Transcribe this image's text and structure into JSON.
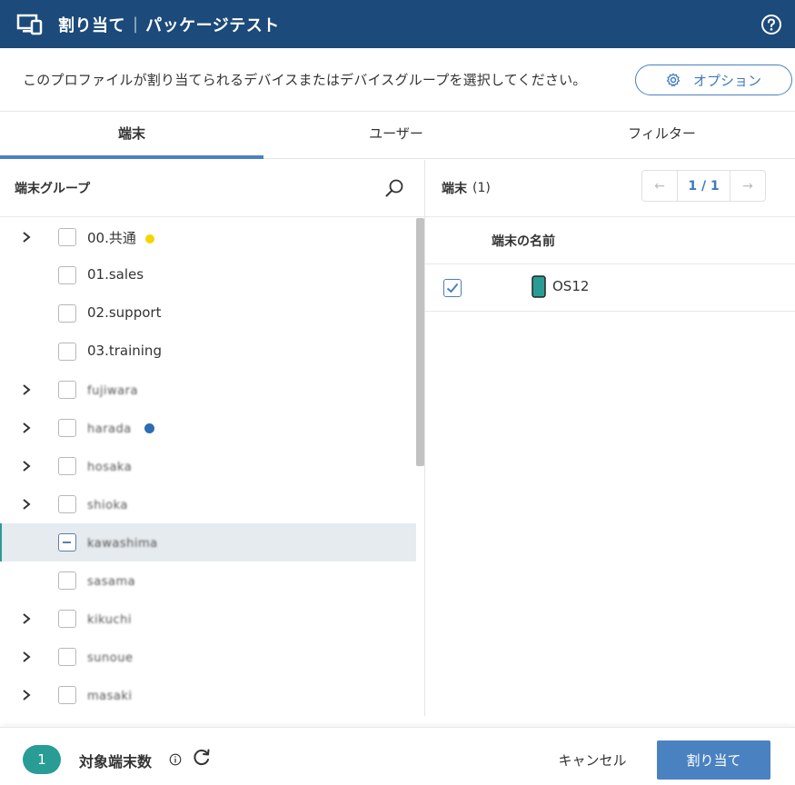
{
  "header": {
    "title_main": "割り当て",
    "separator": "|",
    "title_sub": "パッケージテスト",
    "app_icon": "devices-icon",
    "help_icon": "help-circle-icon"
  },
  "instruction": {
    "text": "このプロファイルが割り当てられるデバイスまたはデバイスグループを選択してください。",
    "option_label": "オプション",
    "option_icon": "gear-icon"
  },
  "tabs": [
    {
      "label": "端末",
      "active": true
    },
    {
      "label": "ユーザー",
      "active": false
    },
    {
      "label": "フィルター",
      "active": false
    }
  ],
  "left_panel": {
    "title": "端末グループ",
    "search_icon": "search-icon",
    "groups": [
      {
        "label": "00.共通",
        "expandable": true,
        "state": "unchecked",
        "marker": "yellow-dot"
      },
      {
        "label": "01.sales",
        "expandable": false,
        "state": "unchecked"
      },
      {
        "label": "02.support",
        "expandable": false,
        "state": "unchecked"
      },
      {
        "label": "03.training",
        "expandable": false,
        "state": "unchecked"
      },
      {
        "label": "fujiwara",
        "expandable": true,
        "state": "unchecked",
        "obscured": true
      },
      {
        "label": "harada",
        "expandable": true,
        "state": "unchecked",
        "obscured": true,
        "marker": "blue-dot"
      },
      {
        "label": "hosaka",
        "expandable": true,
        "state": "unchecked",
        "obscured": true
      },
      {
        "label": "shioka",
        "expandable": true,
        "state": "unchecked",
        "obscured": true
      },
      {
        "label": "kawashima",
        "expandable": false,
        "state": "indeterminate",
        "obscured": true,
        "selected": true
      },
      {
        "label": "sasama",
        "expandable": false,
        "state": "unchecked",
        "obscured": true
      },
      {
        "label": "kikuchi",
        "expandable": true,
        "state": "unchecked",
        "obscured": true
      },
      {
        "label": "sunoue",
        "expandable": true,
        "state": "unchecked",
        "obscured": true
      },
      {
        "label": "masaki",
        "expandable": true,
        "state": "unchecked",
        "obscured": true
      }
    ]
  },
  "right_panel": {
    "title": "端末",
    "count": "(1)",
    "pager": {
      "prev": "←",
      "page": "1 / 1",
      "next": "→"
    },
    "column_header": "端末の名前",
    "devices": [
      {
        "name": "OS12",
        "checked": true,
        "icon": "phone-icon"
      }
    ]
  },
  "footer": {
    "count": "1",
    "target_label": "対象端末数",
    "info_icon": "info-icon",
    "refresh_icon": "refresh-icon",
    "cancel_label": "キャンセル",
    "assign_label": "割り当て"
  },
  "colors": {
    "header_bg": "#1c4a7a",
    "accent": "#4a82c1",
    "teal": "#2a9c96",
    "selected_row": "#e6ebef"
  }
}
